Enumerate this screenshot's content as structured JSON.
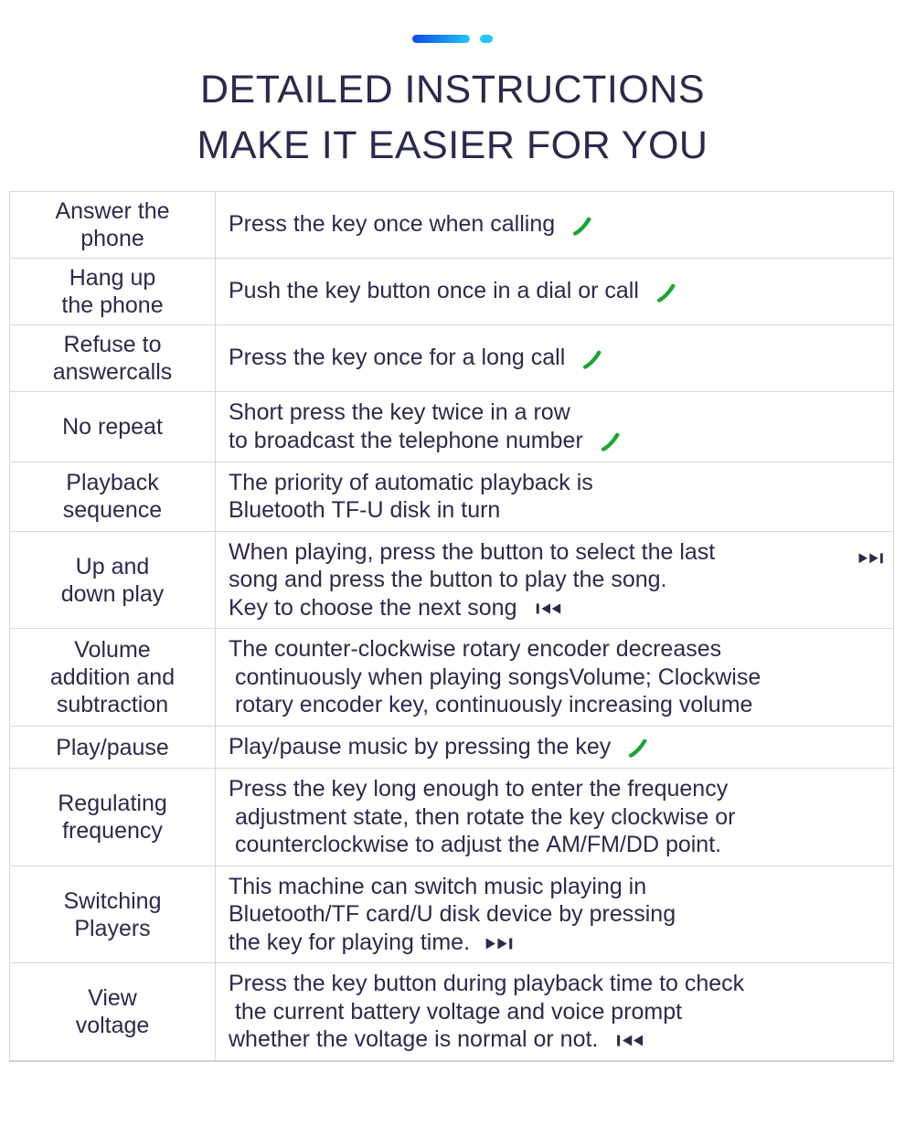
{
  "header": {
    "decor": {
      "bar_gradient_from": "#0c4de8",
      "bar_gradient_to": "#22c8f5",
      "dot_color": "#22c8f5"
    },
    "title_line1": "DETAILED INSTRUCTIONS",
    "title_line2": "MAKE IT EASIER FOR YOU",
    "title_color": "#2b2a4c"
  },
  "icons": {
    "phone": "phone-handset-icon",
    "next_track": "next-track-icon",
    "previous_track": "previous-track-icon",
    "phone_color": "#17a630",
    "track_color": "#2b2a4c"
  },
  "table": {
    "rows": [
      {
        "label_line1": "Answer the",
        "label_line2": "phone",
        "lines": [
          "Press the key once when calling"
        ],
        "icon": "phone-handset-icon",
        "icon_position": "inline-end"
      },
      {
        "label_line1": "Hang up",
        "label_line2": "the phone",
        "lines": [
          "Push the key button once in a dial or call"
        ],
        "icon": "phone-handset-icon",
        "icon_position": "inline-end"
      },
      {
        "label_line1": "Refuse to",
        "label_line2": "answercalls",
        "lines": [
          "Press the key once for a long call"
        ],
        "icon": "phone-handset-icon",
        "icon_position": "inline-end"
      },
      {
        "label_line1": "No repeat",
        "label_line2": "",
        "lines": [
          "Short press the key twice in a row",
          "to broadcast the telephone number"
        ],
        "icon": "phone-handset-icon",
        "icon_position": "inline-end-line2"
      },
      {
        "label_line1": "Playback",
        "label_line2": "sequence",
        "lines": [
          "The priority of automatic playback is",
          "Bluetooth TF-U disk in turn"
        ],
        "icon": "",
        "icon_position": "none"
      },
      {
        "label_line1": "Up and",
        "label_line2": "down play",
        "lines": [
          "When playing, press the button to select the last",
          "song and press the button to play the song.",
          "Key to choose the next song"
        ],
        "icon": "next-track-icon",
        "icon2": "previous-track-icon",
        "icon_position": "corner-and-line3"
      },
      {
        "label_line1": "Volume",
        "label_line2": "addition and",
        "label_line3": "subtraction",
        "lines": [
          "The counter-clockwise rotary encoder decreases",
          " continuously when playing songsVolume; Clockwise",
          " rotary encoder key, continuously increasing volume"
        ],
        "icon": "",
        "icon_position": "none"
      },
      {
        "label_line1": "Play/pause",
        "label_line2": "",
        "lines": [
          "Play/pause music by pressing the key"
        ],
        "icon": "phone-handset-icon",
        "icon_position": "inline-end"
      },
      {
        "label_line1": "Regulating",
        "label_line2": "frequency",
        "lines": [
          "Press the key long enough to enter the frequency",
          " adjustment state, then rotate the key clockwise or",
          " counterclockwise to adjust the AM/FM/DD point."
        ],
        "icon": "",
        "icon_position": "none"
      },
      {
        "label_line1": "Switching",
        "label_line2": "Players",
        "lines": [
          "This machine can switch music playing in",
          "Bluetooth/TF card/U disk device by pressing",
          "the key for playing time."
        ],
        "icon": "next-track-icon",
        "icon_position": "inline-end-last"
      },
      {
        "label_line1": "View",
        "label_line2": "voltage",
        "lines": [
          "Press the key button during playback time to check",
          " the current battery voltage and voice prompt",
          "whether the voltage is normal or not."
        ],
        "icon": "previous-track-icon",
        "icon_position": "inline-end-last"
      }
    ]
  }
}
